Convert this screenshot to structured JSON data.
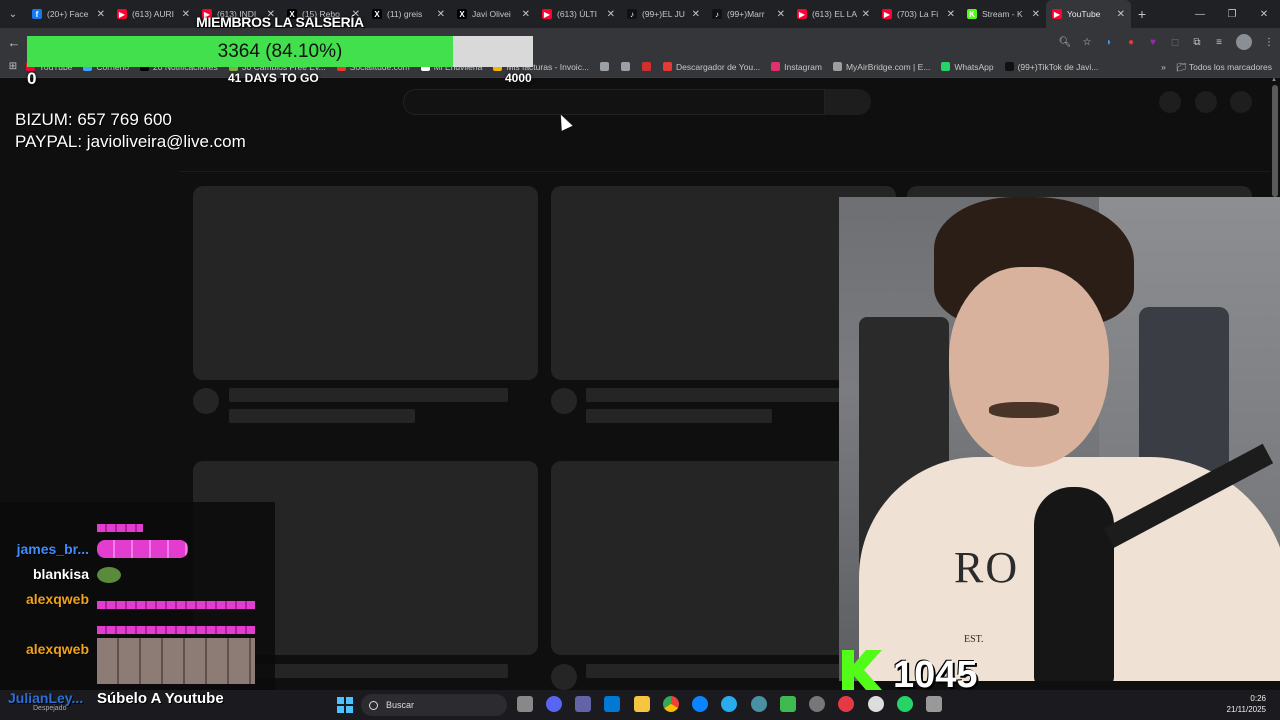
{
  "browser": {
    "tabs": [
      {
        "title": "(20+) Face",
        "color": "#1877f2",
        "glyph": "f"
      },
      {
        "title": "(613) AURI",
        "color": "#ff0033",
        "glyph": "▶"
      },
      {
        "title": "(613) INDI",
        "color": "#ff0033",
        "glyph": "▶"
      },
      {
        "title": "(15) Rebo",
        "color": "#000000",
        "glyph": "X"
      },
      {
        "title": "(11) greis",
        "color": "#000000",
        "glyph": "X"
      },
      {
        "title": "Javi Olivei",
        "color": "#000000",
        "glyph": "X"
      },
      {
        "title": "(613) ÚLTI",
        "color": "#ff0033",
        "glyph": "▶"
      },
      {
        "title": "(99+)EL JU",
        "color": "#111111",
        "glyph": "♪"
      },
      {
        "title": "(99+)Marr",
        "color": "#111111",
        "glyph": "♪"
      },
      {
        "title": "(613) EL LA",
        "color": "#ff0033",
        "glyph": "▶"
      },
      {
        "title": "(703) La Fi",
        "color": "#ff0033",
        "glyph": "▶"
      },
      {
        "title": "Stream - K",
        "color": "#53fc18",
        "glyph": "K"
      },
      {
        "title": "YouTube",
        "color": "#ff0033",
        "glyph": "▶"
      }
    ],
    "active_tab_index": 12,
    "bookmarks": [
      {
        "label": "YouTube",
        "color": "#ff0033"
      },
      {
        "label": "Cornerio",
        "color": "#3ea6ff"
      },
      {
        "label": "20 Notificaciones",
        "color": "#000000"
      },
      {
        "label": "30 Cambios Free Ev...",
        "color": "#7cb342"
      },
      {
        "label": "Socialitude.com",
        "color": "#e53935"
      },
      {
        "label": "Mi Endvilena",
        "color": "#ffffff"
      },
      {
        "label": "Mis facturas - Invoic...",
        "color": "#f4b400"
      },
      {
        "label": "",
        "color": "#9aa0a6"
      },
      {
        "label": "",
        "color": "#9aa0a6"
      },
      {
        "label": "",
        "color": "#d32f2f"
      },
      {
        "label": "Descargador de You...",
        "color": "#e53935"
      },
      {
        "label": "Instagram",
        "color": "#e1306c"
      },
      {
        "label": "MyAirBridge.com | E...",
        "color": "#9e9e9e"
      },
      {
        "label": "WhatsApp",
        "color": "#25d366"
      },
      {
        "label": "(99+)TikTok de Javi...",
        "color": "#111111"
      }
    ],
    "all_bookmarks_label": "Todos los marcadores"
  },
  "overlay": {
    "members_title": "MIEMBROS LA SALSERÍA",
    "goal_text": "3364 (84.10%)",
    "goal_progress": 0.841,
    "goal_min": "0",
    "goal_days": "41 DAYS TO GO",
    "goal_max": "4000",
    "donate_line1": "BIZUM: 657 769 600",
    "donate_line2": "PAYPAL: javioliveira@live.com",
    "kick_count": "1045",
    "webcam_shirt_text": "RO",
    "webcam_shirt_sub": "EST."
  },
  "chat": {
    "messages": [
      {
        "user": "james_br...",
        "color": "#3f8cff"
      },
      {
        "user": "blankisa",
        "color": "#ffffff"
      },
      {
        "user": "alexqweb",
        "color": "#f0a21a"
      },
      {
        "user": "alexqweb",
        "color": "#f0a21a"
      }
    ],
    "footer_user": "JulianLey...",
    "footer_sub": "Despejado",
    "footer_msg": "Súbelo A Youtube"
  },
  "taskbar": {
    "search_placeholder": "Buscar",
    "time": "0:26",
    "date": "21/11/2025"
  }
}
